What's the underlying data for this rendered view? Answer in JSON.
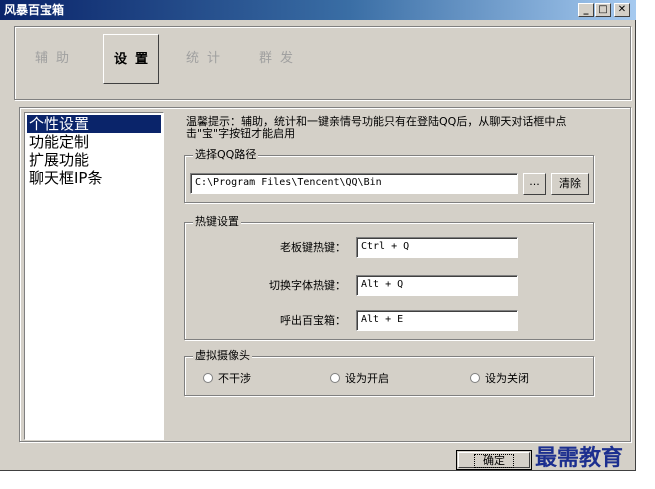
{
  "window": {
    "title": "风暴百宝箱",
    "min_label": "_",
    "max_label": "□",
    "close_label": "✕"
  },
  "toolbar": {
    "buttons": [
      {
        "label": "辅助",
        "active": false
      },
      {
        "label": "设置",
        "active": true
      },
      {
        "label": "统计",
        "active": false
      },
      {
        "label": "群发",
        "active": false
      }
    ]
  },
  "sidebar": {
    "items": [
      {
        "label": "个性设置",
        "selected": true
      },
      {
        "label": "功能定制",
        "selected": false
      },
      {
        "label": "扩展功能",
        "selected": false
      },
      {
        "label": "聊天框IP条",
        "selected": false
      }
    ]
  },
  "main": {
    "tip": "温馨提示：辅助，统计和一键亲情号功能只有在登陆QQ后，从聊天对话框中点击\"宝\"字按钮才能启用",
    "qq_path": {
      "legend": "选择QQ路径",
      "value": "C:\\Program Files\\Tencent\\QQ\\Bin",
      "browse_label": "...",
      "clear_label": "清除"
    },
    "hotkeys": {
      "legend": "热键设置",
      "boss_key_label": "老板键热键：",
      "boss_key_value": "Ctrl + Q",
      "font_switch_label": "切换字体热键：",
      "font_switch_value": "Alt + Q",
      "call_box_label": "呼出百宝箱：",
      "call_box_value": "Alt + E"
    },
    "camera": {
      "legend": "虚拟摄像头",
      "options": [
        "不干涉",
        "设为开启",
        "设为关闭"
      ]
    }
  },
  "footer": {
    "ok_label": "确定"
  },
  "watermark": {
    "text": "最需教育"
  },
  "colors": {
    "titlebar_start": "#0a246a",
    "titlebar_end": "#a6caf0",
    "window_bg": "#d4d0c8",
    "selection": "#0a246a",
    "watermark": "#1c2f8f"
  }
}
